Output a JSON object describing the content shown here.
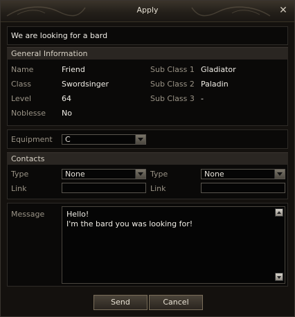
{
  "window": {
    "title": "Apply",
    "close_glyph": "✕"
  },
  "party_message": "We are looking for a bard",
  "general_info": {
    "header": "General Information",
    "name_label": "Name",
    "name_value": "Friend",
    "class_label": "Class",
    "class_value": "Swordsinger",
    "level_label": "Level",
    "level_value": "64",
    "noblesse_label": "Noblesse",
    "noblesse_value": "No",
    "subclass1_label": "Sub Class 1",
    "subclass1_value": "Gladiator",
    "subclass2_label": "Sub Class 2",
    "subclass2_value": "Paladin",
    "subclass3_label": "Sub Class 3",
    "subclass3_value": "-"
  },
  "equipment": {
    "label": "Equipment",
    "selected": "C"
  },
  "contacts": {
    "header": "Contacts",
    "type1_label": "Type",
    "type1_selected": "None",
    "type2_label": "Type",
    "type2_selected": "None",
    "link1_label": "Link",
    "link1_value": "",
    "link2_label": "Link",
    "link2_value": ""
  },
  "message": {
    "label": "Message",
    "line1": "Hello!",
    "line2": "I'm the bard you was looking for!"
  },
  "buttons": {
    "send": "Send",
    "cancel": "Cancel"
  }
}
